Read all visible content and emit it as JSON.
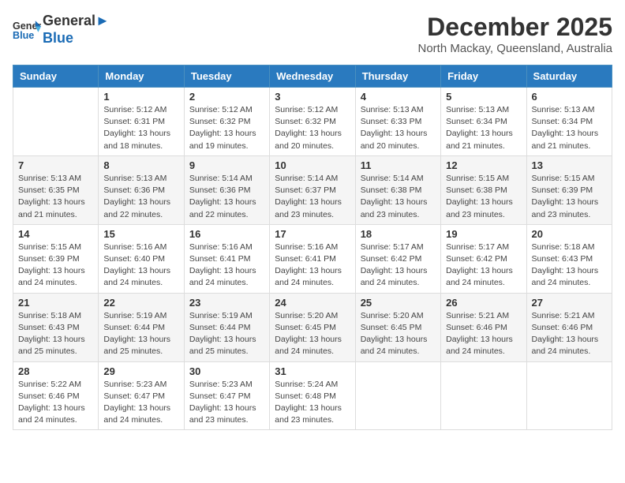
{
  "logo": {
    "line1": "General",
    "line2": "Blue"
  },
  "title": "December 2025",
  "location": "North Mackay, Queensland, Australia",
  "weekdays": [
    "Sunday",
    "Monday",
    "Tuesday",
    "Wednesday",
    "Thursday",
    "Friday",
    "Saturday"
  ],
  "weeks": [
    [
      {
        "day": "",
        "info": ""
      },
      {
        "day": "1",
        "info": "Sunrise: 5:12 AM\nSunset: 6:31 PM\nDaylight: 13 hours\nand 18 minutes."
      },
      {
        "day": "2",
        "info": "Sunrise: 5:12 AM\nSunset: 6:32 PM\nDaylight: 13 hours\nand 19 minutes."
      },
      {
        "day": "3",
        "info": "Sunrise: 5:12 AM\nSunset: 6:32 PM\nDaylight: 13 hours\nand 20 minutes."
      },
      {
        "day": "4",
        "info": "Sunrise: 5:13 AM\nSunset: 6:33 PM\nDaylight: 13 hours\nand 20 minutes."
      },
      {
        "day": "5",
        "info": "Sunrise: 5:13 AM\nSunset: 6:34 PM\nDaylight: 13 hours\nand 21 minutes."
      },
      {
        "day": "6",
        "info": "Sunrise: 5:13 AM\nSunset: 6:34 PM\nDaylight: 13 hours\nand 21 minutes."
      }
    ],
    [
      {
        "day": "7",
        "info": ""
      },
      {
        "day": "8",
        "info": "Sunrise: 5:13 AM\nSunset: 6:36 PM\nDaylight: 13 hours\nand 22 minutes."
      },
      {
        "day": "9",
        "info": "Sunrise: 5:14 AM\nSunset: 6:36 PM\nDaylight: 13 hours\nand 22 minutes."
      },
      {
        "day": "10",
        "info": "Sunrise: 5:14 AM\nSunset: 6:37 PM\nDaylight: 13 hours\nand 23 minutes."
      },
      {
        "day": "11",
        "info": "Sunrise: 5:14 AM\nSunset: 6:38 PM\nDaylight: 13 hours\nand 23 minutes."
      },
      {
        "day": "12",
        "info": "Sunrise: 5:15 AM\nSunset: 6:38 PM\nDaylight: 13 hours\nand 23 minutes."
      },
      {
        "day": "13",
        "info": "Sunrise: 5:15 AM\nSunset: 6:39 PM\nDaylight: 13 hours\nand 23 minutes."
      }
    ],
    [
      {
        "day": "14",
        "info": ""
      },
      {
        "day": "15",
        "info": "Sunrise: 5:16 AM\nSunset: 6:40 PM\nDaylight: 13 hours\nand 24 minutes."
      },
      {
        "day": "16",
        "info": "Sunrise: 5:16 AM\nSunset: 6:41 PM\nDaylight: 13 hours\nand 24 minutes."
      },
      {
        "day": "17",
        "info": "Sunrise: 5:16 AM\nSunset: 6:41 PM\nDaylight: 13 hours\nand 24 minutes."
      },
      {
        "day": "18",
        "info": "Sunrise: 5:17 AM\nSunset: 6:42 PM\nDaylight: 13 hours\nand 24 minutes."
      },
      {
        "day": "19",
        "info": "Sunrise: 5:17 AM\nSunset: 6:42 PM\nDaylight: 13 hours\nand 24 minutes."
      },
      {
        "day": "20",
        "info": "Sunrise: 5:18 AM\nSunset: 6:43 PM\nDaylight: 13 hours\nand 24 minutes."
      }
    ],
    [
      {
        "day": "21",
        "info": ""
      },
      {
        "day": "22",
        "info": "Sunrise: 5:19 AM\nSunset: 6:44 PM\nDaylight: 13 hours\nand 25 minutes."
      },
      {
        "day": "23",
        "info": "Sunrise: 5:19 AM\nSunset: 6:44 PM\nDaylight: 13 hours\nand 25 minutes."
      },
      {
        "day": "24",
        "info": "Sunrise: 5:20 AM\nSunset: 6:45 PM\nDaylight: 13 hours\nand 24 minutes."
      },
      {
        "day": "25",
        "info": "Sunrise: 5:20 AM\nSunset: 6:45 PM\nDaylight: 13 hours\nand 24 minutes."
      },
      {
        "day": "26",
        "info": "Sunrise: 5:21 AM\nSunset: 6:46 PM\nDaylight: 13 hours\nand 24 minutes."
      },
      {
        "day": "27",
        "info": "Sunrise: 5:21 AM\nSunset: 6:46 PM\nDaylight: 13 hours\nand 24 minutes."
      }
    ],
    [
      {
        "day": "28",
        "info": "Sunrise: 5:22 AM\nSunset: 6:46 PM\nDaylight: 13 hours\nand 24 minutes."
      },
      {
        "day": "29",
        "info": "Sunrise: 5:23 AM\nSunset: 6:47 PM\nDaylight: 13 hours\nand 24 minutes."
      },
      {
        "day": "30",
        "info": "Sunrise: 5:23 AM\nSunset: 6:47 PM\nDaylight: 13 hours\nand 23 minutes."
      },
      {
        "day": "31",
        "info": "Sunrise: 5:24 AM\nSunset: 6:48 PM\nDaylight: 13 hours\nand 23 minutes."
      },
      {
        "day": "",
        "info": ""
      },
      {
        "day": "",
        "info": ""
      },
      {
        "day": "",
        "info": ""
      }
    ]
  ],
  "week7_sunday": "Sunrise: 5:13 AM\nSunset: 6:35 PM\nDaylight: 13 hours\nand 21 minutes.",
  "week14_sunday": "Sunrise: 5:15 AM\nSunset: 6:39 PM\nDaylight: 13 hours\nand 24 minutes.",
  "week21_sunday": "Sunrise: 5:18 AM\nSunset: 6:43 PM\nDaylight: 13 hours\nand 25 minutes."
}
